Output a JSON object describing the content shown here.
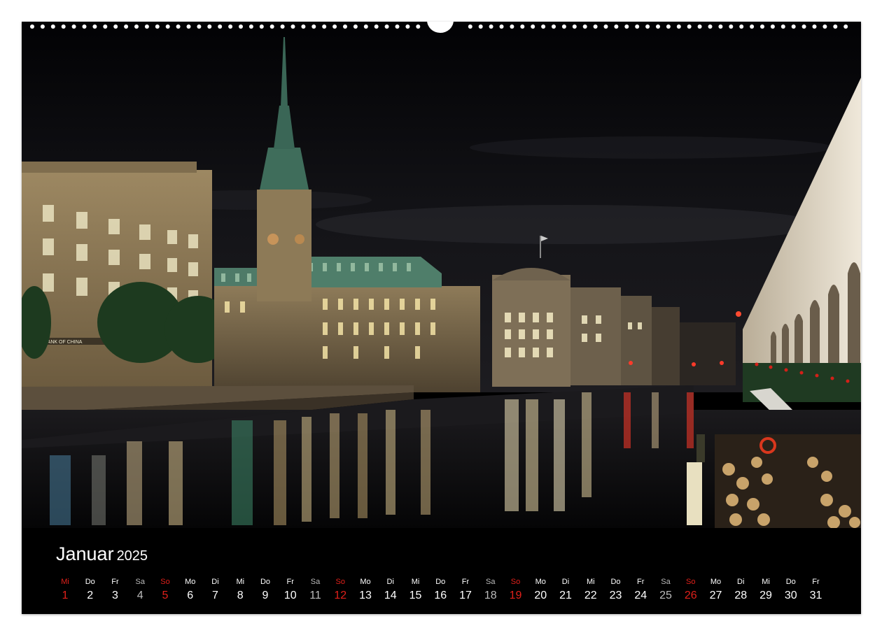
{
  "calendar": {
    "month_name": "Januar",
    "year": "2025",
    "days": [
      {
        "weekday": "Mi",
        "day": "1",
        "kind": "holiday"
      },
      {
        "weekday": "Do",
        "day": "2",
        "kind": "weekday"
      },
      {
        "weekday": "Fr",
        "day": "3",
        "kind": "weekday"
      },
      {
        "weekday": "Sa",
        "day": "4",
        "kind": "saturday"
      },
      {
        "weekday": "So",
        "day": "5",
        "kind": "sunday"
      },
      {
        "weekday": "Mo",
        "day": "6",
        "kind": "weekday"
      },
      {
        "weekday": "Di",
        "day": "7",
        "kind": "weekday"
      },
      {
        "weekday": "Mi",
        "day": "8",
        "kind": "weekday"
      },
      {
        "weekday": "Do",
        "day": "9",
        "kind": "weekday"
      },
      {
        "weekday": "Fr",
        "day": "10",
        "kind": "weekday"
      },
      {
        "weekday": "Sa",
        "day": "11",
        "kind": "saturday"
      },
      {
        "weekday": "So",
        "day": "12",
        "kind": "sunday"
      },
      {
        "weekday": "Mo",
        "day": "13",
        "kind": "weekday"
      },
      {
        "weekday": "Di",
        "day": "14",
        "kind": "weekday"
      },
      {
        "weekday": "Mi",
        "day": "15",
        "kind": "weekday"
      },
      {
        "weekday": "Do",
        "day": "16",
        "kind": "weekday"
      },
      {
        "weekday": "Fr",
        "day": "17",
        "kind": "weekday"
      },
      {
        "weekday": "Sa",
        "day": "18",
        "kind": "saturday"
      },
      {
        "weekday": "So",
        "day": "19",
        "kind": "sunday"
      },
      {
        "weekday": "Mo",
        "day": "20",
        "kind": "weekday"
      },
      {
        "weekday": "Di",
        "day": "21",
        "kind": "weekday"
      },
      {
        "weekday": "Mi",
        "day": "22",
        "kind": "weekday"
      },
      {
        "weekday": "Do",
        "day": "23",
        "kind": "weekday"
      },
      {
        "weekday": "Fr",
        "day": "24",
        "kind": "weekday"
      },
      {
        "weekday": "Sa",
        "day": "25",
        "kind": "saturday"
      },
      {
        "weekday": "So",
        "day": "26",
        "kind": "sunday"
      },
      {
        "weekday": "Mo",
        "day": "27",
        "kind": "weekday"
      },
      {
        "weekday": "Di",
        "day": "28",
        "kind": "weekday"
      },
      {
        "weekday": "Mi",
        "day": "29",
        "kind": "weekday"
      },
      {
        "weekday": "Do",
        "day": "30",
        "kind": "weekday"
      },
      {
        "weekday": "Fr",
        "day": "31",
        "kind": "weekday"
      }
    ]
  },
  "photo": {
    "signs": {
      "bank_sign": "BANK OF CHINA"
    }
  },
  "colors": {
    "sheet_background": "#000000",
    "text": "#ffffff",
    "sunday_holiday": "#e0201a",
    "saturday": "#bbbbbb"
  }
}
